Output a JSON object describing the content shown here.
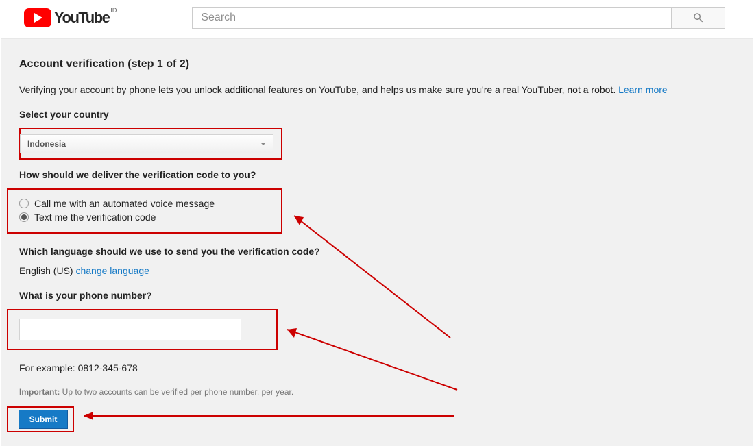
{
  "header": {
    "logo_text": "YouTube",
    "logo_sup": "ID",
    "search_placeholder": "Search"
  },
  "main": {
    "title": "Account verification (step 1 of 2)",
    "desc": "Verifying your account by phone lets you unlock additional features on YouTube, and helps us make sure you're a real YouTuber, not a robot. ",
    "learn_more": "Learn more",
    "country_label": "Select your country",
    "country_value": "Indonesia",
    "deliver_label": "How should we deliver the verification code to you?",
    "radio_call": "Call me with an automated voice message",
    "radio_text": "Text me the verification code",
    "lang_label": "Which language should we use to send you the verification code?",
    "lang_value": "English (US) ",
    "lang_change": "change language",
    "phone_label": "What is your phone number?",
    "example": "For example: 0812-345-678",
    "note_bold": "Important:",
    "note_text": " Up to two accounts can be verified per phone number, per year.",
    "submit": "Submit"
  }
}
